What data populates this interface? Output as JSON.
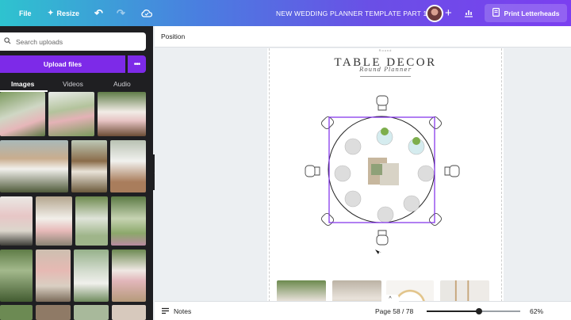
{
  "topbar": {
    "file_label": "File",
    "resize_label": "Resize",
    "title": "NEW WEDDING PLANNER TEMPLATE PART 1",
    "print_label": "Print Letterheads",
    "icons": [
      "undo-icon",
      "redo-icon",
      "cloud-icon",
      "plus-icon",
      "stats-icon",
      "print-icon"
    ]
  },
  "uploads": {
    "search_placeholder": "Search uploads",
    "upload_button": "Upload files",
    "tabs": [
      "Images",
      "Videos",
      "Audio"
    ],
    "active_tab": "Images"
  },
  "editor": {
    "context_label": "Position",
    "page": {
      "header_small": "Round",
      "title": "TABLE DECOR",
      "subtitle": "Round Planner"
    }
  },
  "bottombar": {
    "notes_label": "Notes",
    "page_indicator": "Page 58 / 78",
    "zoom_percent": 62,
    "zoom_label": "62%"
  },
  "colors": {
    "upload_button": "#7d2ae8",
    "selection": "#7d2ae8",
    "panel_bg": "#1f1f22"
  }
}
